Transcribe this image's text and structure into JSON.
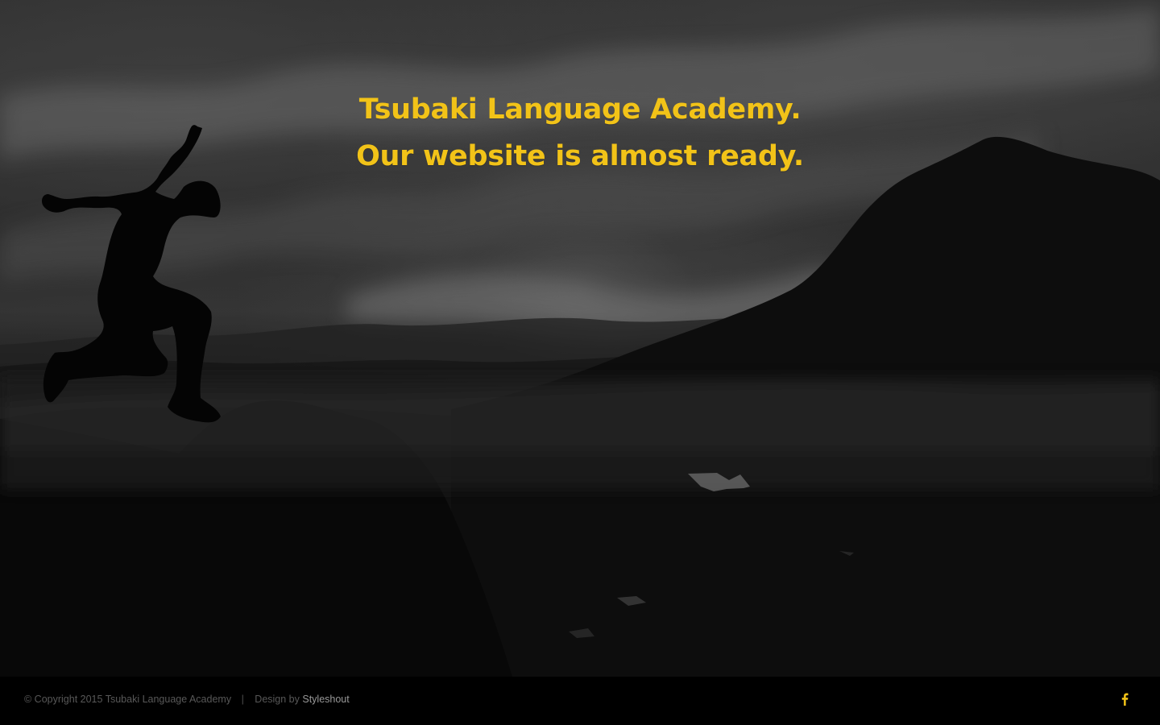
{
  "hero": {
    "line1": "Tsubaki Language Academy.",
    "line2": "Our website is almost ready."
  },
  "footer": {
    "copyright": "© Copyright 2015 Tsubaki Language Academy",
    "separator": "|",
    "design_prefix": "Design by ",
    "designer": "Styleshout",
    "social_icon": "facebook-icon"
  },
  "colors": {
    "accent": "#f2c318",
    "footer_background": "#000000",
    "footer_text": "#585858",
    "footer_link": "#989898"
  }
}
